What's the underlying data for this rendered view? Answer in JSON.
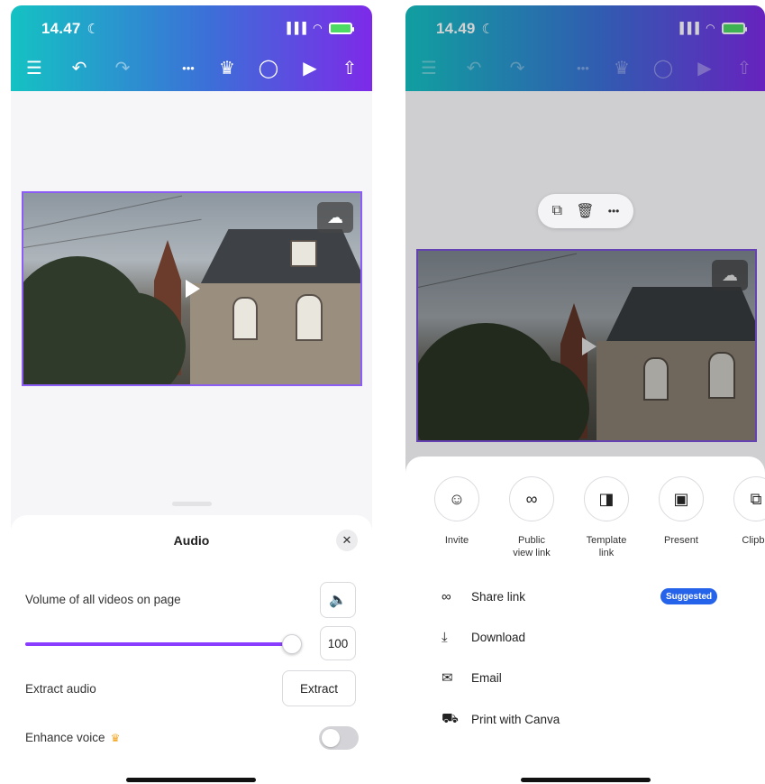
{
  "left": {
    "status": {
      "time": "14.47",
      "moon": "☾",
      "signal": "▐▐▐",
      "wifi": "◠"
    },
    "toolbar": {
      "menu": "☰",
      "undo": "↶",
      "redo": "↷",
      "more": "•••",
      "crown": "♛",
      "comment": "◯",
      "play": "▶",
      "share": "⇧"
    },
    "canvas": {
      "upload": "☁"
    },
    "audio_panel": {
      "title": "Audio",
      "close": "✕",
      "volume_label": "Volume of all videos on page",
      "volume_icon": "🔈",
      "volume_value": "100",
      "volume_level": 1.0,
      "extract_label": "Extract audio",
      "extract_button": "Extract",
      "enhance_label": "Enhance voice",
      "enhance_crown": "♛",
      "enhance_on": false
    }
  },
  "right": {
    "status": {
      "time": "14.49",
      "moon": "☾",
      "signal": "▐▐▐",
      "wifi": "◠"
    },
    "toolbar": {
      "menu": "☰",
      "undo": "↶",
      "redo": "↷",
      "more": "•••",
      "crown": "♛",
      "comment": "◯",
      "play": "▶",
      "share": "⇧"
    },
    "float_bar": {
      "duplicate": "⧉",
      "delete": "🗑",
      "more": "•••"
    },
    "canvas": {
      "upload": "☁"
    },
    "share_sheet": {
      "options": [
        {
          "label": "Invite",
          "icon": "☺"
        },
        {
          "label": "Public view link",
          "icon": "∞"
        },
        {
          "label": "Template link",
          "icon": "◨"
        },
        {
          "label": "Present",
          "icon": "▣"
        },
        {
          "label": "Clipbo",
          "icon": "⧉"
        }
      ],
      "rows": [
        {
          "label": "Share link",
          "icon": "∞",
          "badge": "Suggested"
        },
        {
          "label": "Download",
          "icon": "⤓"
        },
        {
          "label": "Email",
          "icon": "✉"
        },
        {
          "label": "Print with Canva",
          "icon": "⛟"
        }
      ]
    }
  }
}
